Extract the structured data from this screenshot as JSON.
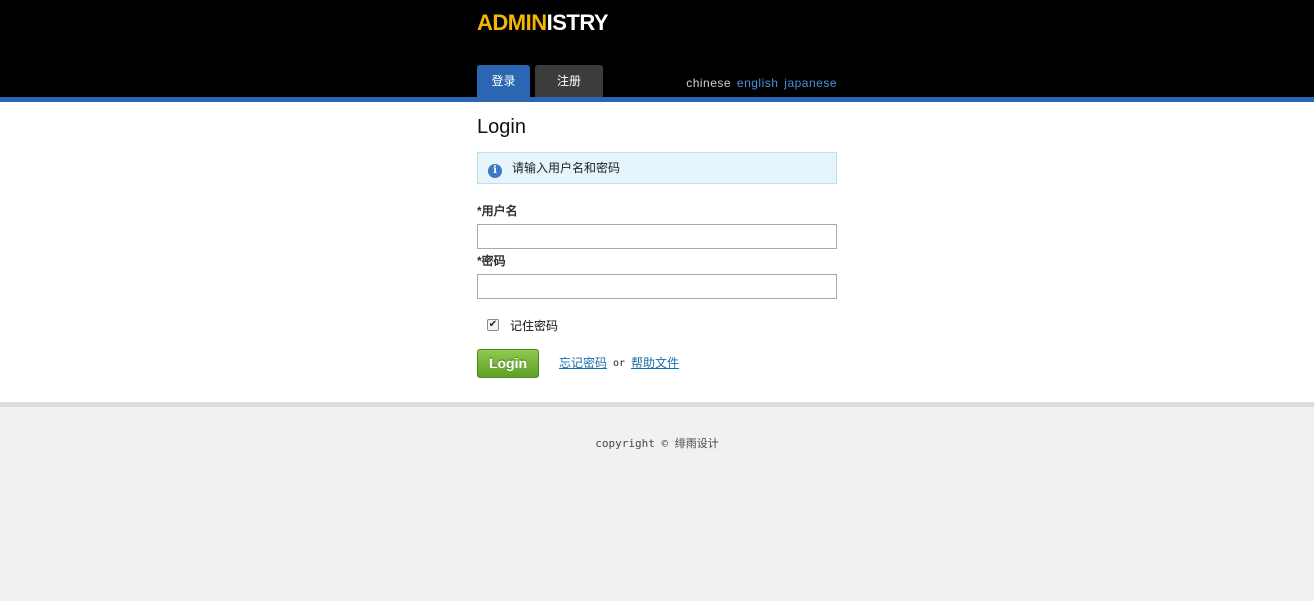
{
  "header": {
    "logo": {
      "part1": "ADMIN",
      "part2": "ISTRY"
    },
    "tabs": [
      {
        "label": "登录",
        "active": true
      },
      {
        "label": "注册",
        "active": false
      }
    ],
    "languages": {
      "current": "chinese",
      "options": [
        "english",
        "japanese"
      ]
    },
    "colors": {
      "logo_accent": "#f2b705",
      "active_tab": "#2a66b2",
      "inactive_tab": "#3c3c3c"
    }
  },
  "main": {
    "title": "Login",
    "notice": {
      "icon": "info-icon",
      "text": "请输入用户名和密码"
    },
    "form": {
      "username": {
        "label": "*用户名",
        "value": "",
        "placeholder": ""
      },
      "password": {
        "label": "*密码",
        "value": "",
        "placeholder": ""
      },
      "remember": {
        "label": "记住密码",
        "checked": true
      },
      "submit_label": "Login"
    },
    "links": {
      "forgot": "忘记密码",
      "or": "or",
      "help": "帮助文件"
    }
  },
  "footer": {
    "copyright": "copyright © 绯雨设计"
  }
}
